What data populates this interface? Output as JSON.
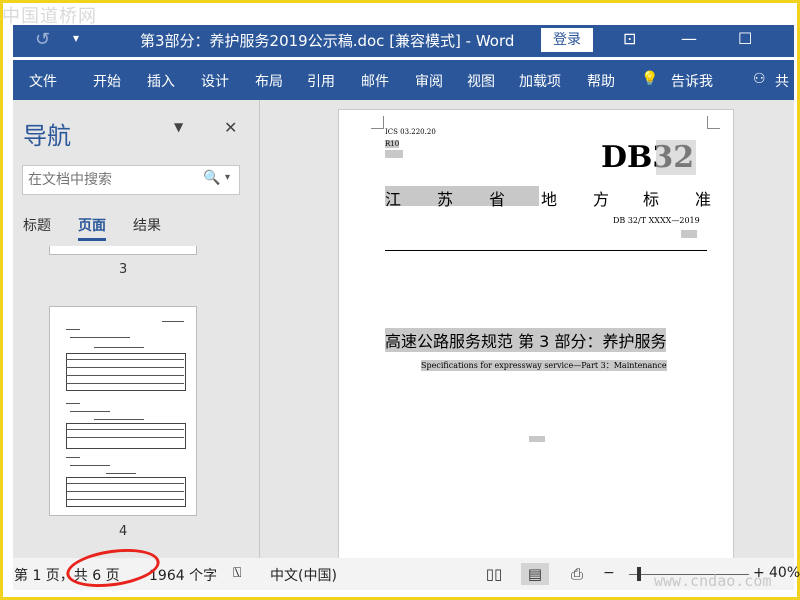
{
  "watermark": "中国道桥网",
  "site_watermark": "www.cndao.com",
  "titlebar": {
    "title": "第3部分：养护服务2019公示稿.doc [兼容模式]  -  Word",
    "login": "登录"
  },
  "ribbon": {
    "tabs": [
      "文件",
      "开始",
      "插入",
      "设计",
      "布局",
      "引用",
      "邮件",
      "审阅",
      "视图",
      "加载项",
      "帮助"
    ],
    "tell_me": "告诉我",
    "share": "共"
  },
  "nav": {
    "title": "导航",
    "search_placeholder": "在文档中搜索",
    "tabs": [
      "标题",
      "页面",
      "结果"
    ],
    "active_tab": "页面",
    "page_labels": [
      "3",
      "4"
    ]
  },
  "document": {
    "ics": "ICS  03.220.20",
    "r10": "R10",
    "db_code": "DB32",
    "province_chars": [
      "江",
      "苏",
      "省",
      "地",
      "方",
      "标",
      "准"
    ],
    "db_number": "DB 32/T  XXXX—2019",
    "title_cn": "高速公路服务规范  第 3 部分：养护服务",
    "title_en": "Specifications for expressway service—Part 3：Maintenance"
  },
  "status": {
    "page": "第 1 页，共 6 页",
    "words": "1964 个字",
    "language": "中文(中国)",
    "zoom": "40%"
  }
}
